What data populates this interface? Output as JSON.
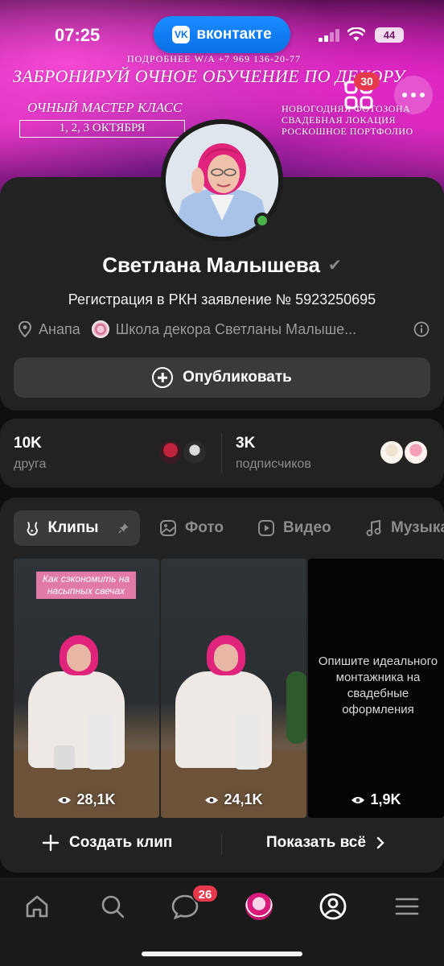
{
  "status_bar": {
    "time": "07:25",
    "app_pill": "вконтакте",
    "app_logo": "VK",
    "battery": "44"
  },
  "cover": {
    "contact": "ПОДРОБНЕЕ W/A +7 969 136-20-77",
    "headline": "ЗАБРОНИРУЙ ОЧНОЕ ОБУЧЕНИЕ ПО ДЕКОРУ",
    "subheadline": "ОЧНЫЙ МАСТЕР КЛАСС",
    "dates": "1, 2, 3 ОКТЯБРЯ",
    "list": [
      "НОВОГОДНЯЯ ФОТОЗОНА",
      "СВАДЕБНАЯ ЛОКАЦИЯ",
      "РОСКОШНОЕ ПОРТФОЛИО"
    ],
    "qr_badge": "30"
  },
  "profile": {
    "name": "Светлана Малышева",
    "verified_mark": "✔",
    "status": "Регистрация в РКН заявление № 5923250695",
    "city": "Анапа",
    "group": "Школа декора Светланы Малыше...",
    "publish_label": "Опубликовать"
  },
  "stats": {
    "friends_count": "10K",
    "friends_label": "друга",
    "followers_count": "3K",
    "followers_label": "подписчиков"
  },
  "tabs": [
    {
      "label": "Клипы"
    },
    {
      "label": "Фото"
    },
    {
      "label": "Видео"
    },
    {
      "label": "Музыка"
    }
  ],
  "clips": [
    {
      "caption": "Как сэкономить на насыпных свечах",
      "views": "28,1K"
    },
    {
      "caption": "",
      "views": "24,1K"
    },
    {
      "caption": "Опишите идеального монтажника на свадебные оформления",
      "views": "1,9K"
    }
  ],
  "clip_actions": {
    "create": "Создать клип",
    "show_all": "Показать всё"
  },
  "bottom_nav": {
    "messages_badge": "26",
    "items": [
      "home-icon",
      "search-icon",
      "messages-icon",
      "profile-avatar",
      "account-icon",
      "menu-icon"
    ]
  },
  "colors": {
    "accent": "#0a6fe6",
    "badge": "#e6394b",
    "online": "#4bb34b",
    "card": "#222222"
  }
}
